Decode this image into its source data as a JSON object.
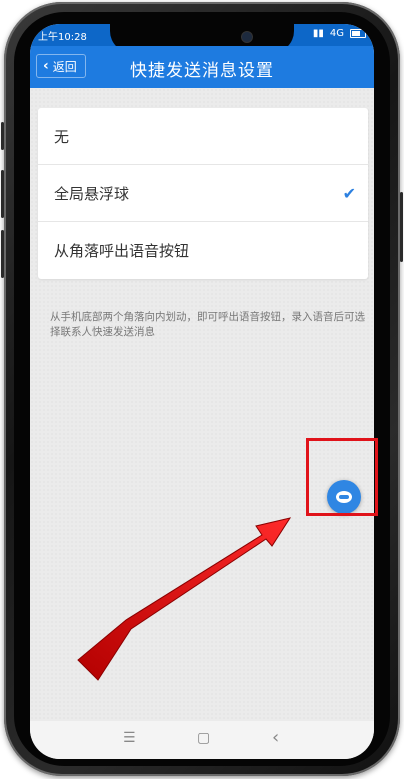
{
  "status_bar": {
    "time": "上午10:28",
    "network": "4G"
  },
  "header": {
    "back_label": "返回",
    "title": "快捷发送消息设置"
  },
  "options": [
    {
      "label": "无",
      "selected": false
    },
    {
      "label": "全局悬浮球",
      "selected": true
    },
    {
      "label": "从角落呼出语音按钮",
      "selected": false
    }
  ],
  "hint_text": "从手机底部两个角落向内划动，即可呼出语音按钮，录入语音后可选择联系人快速发送消息",
  "icons": {
    "back": "chevron-left-icon",
    "check": "check-icon",
    "float_ball": "chat-bubble-icon",
    "nav_menu": "menu-icon",
    "nav_home": "home-icon",
    "nav_back": "back-icon"
  },
  "glyphs": {
    "check": "✔",
    "menu": "☰",
    "home": "▢",
    "back": "‹",
    "back_arrow": "‹"
  },
  "colors": {
    "header": "#1e7be0",
    "accent": "#2c80e0",
    "highlight": "#e0131a"
  }
}
